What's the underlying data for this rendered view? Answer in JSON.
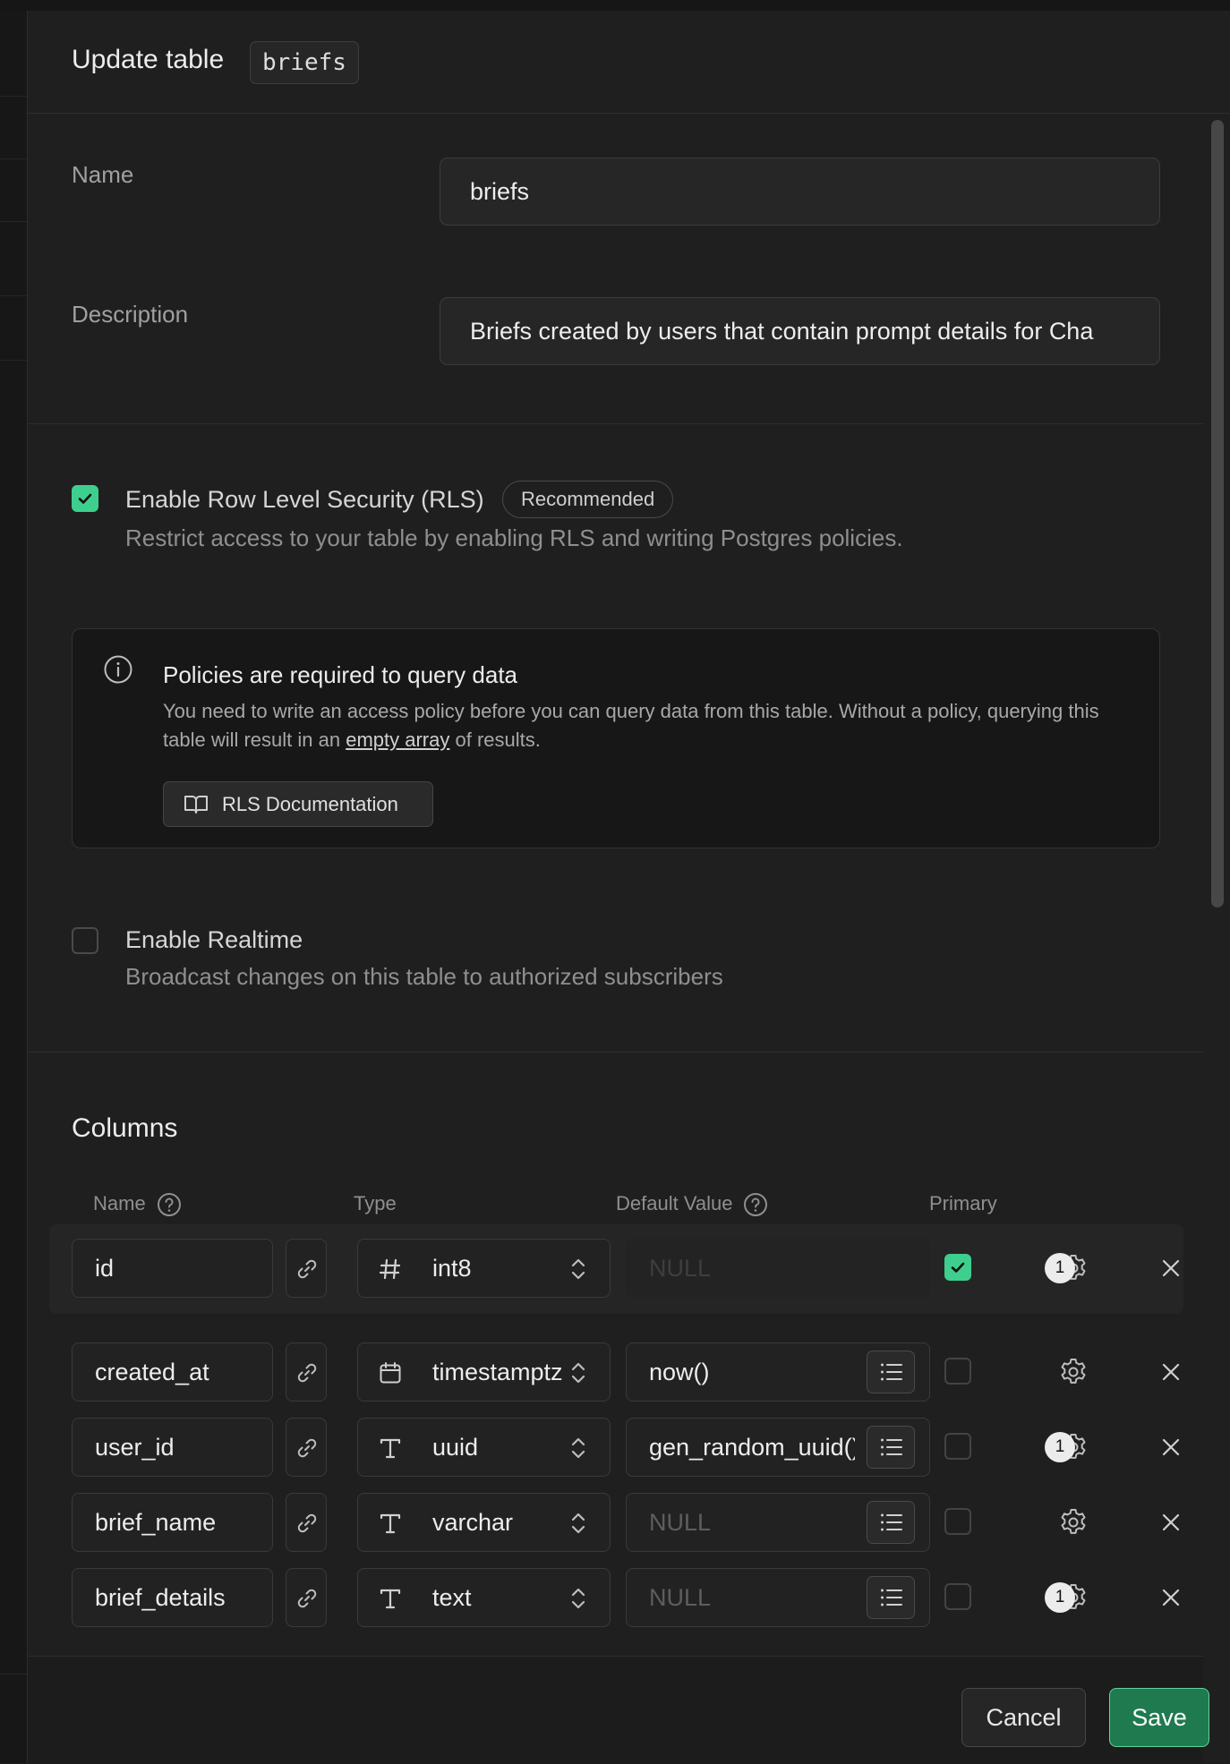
{
  "header": {
    "title": "Update table",
    "table_name": "briefs"
  },
  "form": {
    "name_label": "Name",
    "name_value": "briefs",
    "description_label": "Description",
    "description_value": "Briefs created by users that contain prompt details for Cha"
  },
  "rls": {
    "checked": true,
    "title": "Enable Row Level Security (RLS)",
    "badge": "Recommended",
    "subtitle": "Restrict access to your table by enabling RLS and writing Postgres policies."
  },
  "alert": {
    "title": "Policies are required to query data",
    "body_part1": "You need to write an access policy before you can query data from this table. Without a policy, querying this table will result in an ",
    "body_link": "empty array",
    "body_part2": " of results.",
    "button_label": "RLS Documentation"
  },
  "realtime": {
    "checked": false,
    "title": "Enable Realtime",
    "subtitle": "Broadcast changes on this table to authorized subscribers"
  },
  "columns": {
    "title": "Columns",
    "headers": {
      "name": "Name",
      "type": "Type",
      "default_value": "Default Value",
      "primary": "Primary"
    },
    "rows": [
      {
        "name": "id",
        "type_icon": "hash-icon",
        "type": "int8",
        "default": "NULL",
        "default_is_null": true,
        "primary": true,
        "badge": "1"
      },
      {
        "name": "created_at",
        "type_icon": "calendar-icon",
        "type": "timestamptz",
        "default": "now()",
        "default_is_null": false,
        "primary": false,
        "badge": ""
      },
      {
        "name": "user_id",
        "type_icon": "text-type-icon",
        "type": "uuid",
        "default": "gen_random_uuid()",
        "default_is_null": false,
        "primary": false,
        "badge": "1"
      },
      {
        "name": "brief_name",
        "type_icon": "text-type-icon",
        "type": "varchar",
        "default": "NULL",
        "default_is_null": true,
        "primary": false,
        "badge": ""
      },
      {
        "name": "brief_details",
        "type_icon": "text-type-icon",
        "type": "text",
        "default": "NULL",
        "default_is_null": true,
        "primary": false,
        "badge": "1"
      }
    ]
  },
  "footer": {
    "cancel_label": "Cancel",
    "save_label": "Save"
  },
  "colors": {
    "accent": "#3ecf8e",
    "save_bg": "#1f7a50",
    "background": "#1f1f1f"
  }
}
